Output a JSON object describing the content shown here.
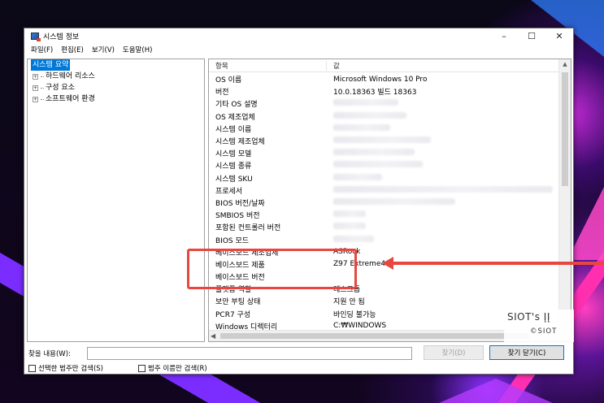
{
  "window": {
    "title": "시스템 정보",
    "minimize": "–",
    "maximize": "☐",
    "close": "✕"
  },
  "menu": [
    "파일(F)",
    "편집(E)",
    "보기(V)",
    "도움말(H)"
  ],
  "tree": {
    "root": "시스템 요약",
    "children": [
      "하드웨어 리소스",
      "구성 요소",
      "소프트웨어 환경"
    ]
  },
  "list": {
    "headers": [
      "항목",
      "값"
    ],
    "rows": [
      {
        "key": "OS 이름",
        "value": "Microsoft Windows 10 Pro"
      },
      {
        "key": "버전",
        "value": "10.0.18363 빌드 18363"
      },
      {
        "key": "기타 OS 설명",
        "value": ""
      },
      {
        "key": "OS 제조업체",
        "value": ""
      },
      {
        "key": "시스템 이름",
        "value": ""
      },
      {
        "key": "시스템 제조업체",
        "value": ""
      },
      {
        "key": "시스템 모델",
        "value": ""
      },
      {
        "key": "시스템 종류",
        "value": ""
      },
      {
        "key": "시스템 SKU",
        "value": ""
      },
      {
        "key": "프로세서",
        "value": ""
      },
      {
        "key": "BIOS 버전/날짜",
        "value": ""
      },
      {
        "key": "SMBIOS 버전",
        "value": ""
      },
      {
        "key": "포함된 컨트롤러 버전",
        "value": ""
      },
      {
        "key": "BIOS 모드",
        "value": ""
      },
      {
        "key": "베이스보드 제조업체",
        "value": "ASRock"
      },
      {
        "key": "베이스보드 제품",
        "value": "Z97 Extreme4"
      },
      {
        "key": "베이스보드 버전",
        "value": ""
      },
      {
        "key": "플랫폼 역할",
        "value": "데스크톱"
      },
      {
        "key": "보안 부팅 상태",
        "value": "지원 안 됨"
      },
      {
        "key": "PCR7 구성",
        "value": "바인딩 불가능"
      },
      {
        "key": "Windows 디렉터리",
        "value": "C:₩WINDOWS"
      }
    ]
  },
  "find": {
    "label": "찾을 내용(W):",
    "value": "",
    "find_button": "찾기(D)",
    "close_find_button": "찾기 닫기(C)",
    "checkbox_selected": "선택한 범주만 검색(S)",
    "checkbox_names": "범주 이름만 검색(R)"
  },
  "watermark": {
    "line1": "SIOT's ĮĮ",
    "line2": "©SIOT"
  },
  "colors": {
    "highlight": "#e8473f",
    "selection": "#0078d7"
  }
}
